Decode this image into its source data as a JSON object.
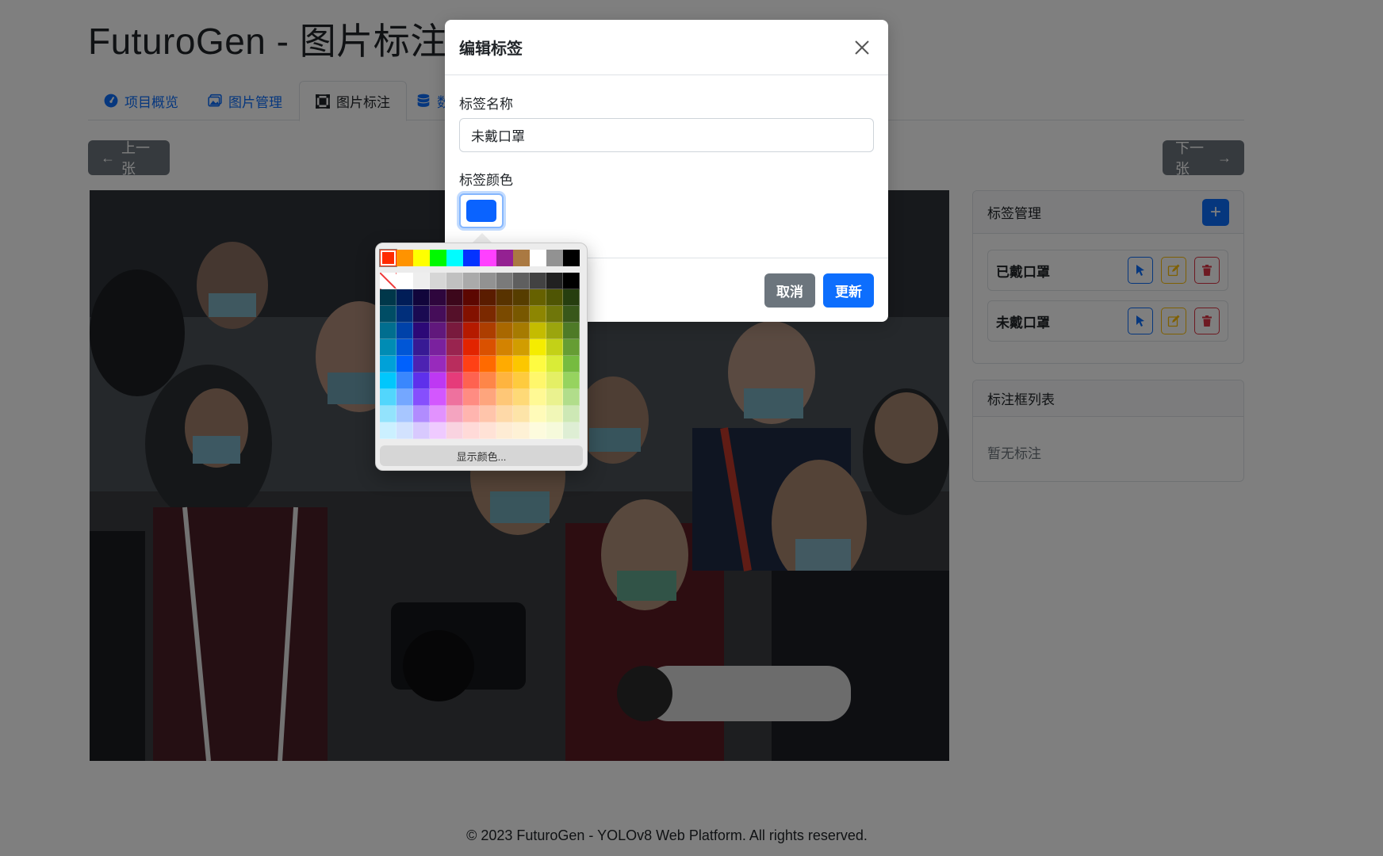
{
  "app_title": "FuturoGen - 图片标注",
  "tabs": [
    {
      "label": "项目概览",
      "icon": "gauge-icon"
    },
    {
      "label": "图片管理",
      "icon": "images-icon"
    },
    {
      "label": "图片标注",
      "icon": "bounding-box-icon",
      "active": true
    },
    {
      "label": "数",
      "icon": "database-icon"
    }
  ],
  "nav": {
    "prev_label": "上一张",
    "next_label": "下一张"
  },
  "label_panel": {
    "title": "标签管理",
    "add_label": "+",
    "labels": [
      {
        "name": "已戴口罩"
      },
      {
        "name": "未戴口罩"
      }
    ]
  },
  "box_panel": {
    "title": "标注框列表",
    "empty_text": "暂无标注"
  },
  "footer": "© 2023 FuturoGen - YOLOv8 Web Platform. All rights reserved.",
  "modal": {
    "title": "编辑标签",
    "name_label": "标签名称",
    "name_value": "未戴口罩",
    "color_label": "标签颜色",
    "color_value": "#0a63ff",
    "cancel_label": "取消",
    "update_label": "更新"
  },
  "palette": {
    "show_colors_label": "显示颜色...",
    "top_row": [
      "#ff2a00",
      "#ff9300",
      "#ffff00",
      "#00f900",
      "#00fdff",
      "#0433ff",
      "#ff40ff",
      "#942192",
      "#aa7942",
      "#ffffff",
      "#929292",
      "#000000"
    ],
    "grid": [
      [
        "none",
        "#ffffff",
        "#eeeeee",
        "#d6d6d6",
        "#c0c0c0",
        "#aaaaaa",
        "#929292",
        "#7a7a7a",
        "#5f5f5f",
        "#424242",
        "#212121",
        "#000000"
      ],
      [
        "#00374a",
        "#011d57",
        "#11053b",
        "#2e063d",
        "#3c071b",
        "#5c0701",
        "#5a1c00",
        "#583300",
        "#563d00",
        "#666100",
        "#4f5504",
        "#263e0f"
      ],
      [
        "#004d65",
        "#012f7b",
        "#1a0a52",
        "#450d59",
        "#551029",
        "#831100",
        "#7b2900",
        "#7a4a00",
        "#785800",
        "#8d8602",
        "#6f760a",
        "#38571a"
      ],
      [
        "#016e8f",
        "#0042a9",
        "#2c0977",
        "#61187c",
        "#791a3d",
        "#b51a00",
        "#ad3e00",
        "#a96800",
        "#a67b01",
        "#c4bc00",
        "#9ba50e",
        "#4e7a27"
      ],
      [
        "#008cb4",
        "#0056d6",
        "#371a94",
        "#7a219e",
        "#99244f",
        "#e22400",
        "#da5100",
        "#d38301",
        "#d19d01",
        "#f5ec00",
        "#c3d117",
        "#669d34"
      ],
      [
        "#00a1d8",
        "#0061fd",
        "#4d22b2",
        "#982abc",
        "#b92d5d",
        "#ff4015",
        "#ff6a00",
        "#ffab01",
        "#fcc700",
        "#fefb41",
        "#d9ec37",
        "#76bb40"
      ],
      [
        "#01c7fc",
        "#3a87fd",
        "#5e30eb",
        "#be38f3",
        "#e63b7a",
        "#fe6250",
        "#fe8648",
        "#feb43f",
        "#fecb3e",
        "#fff76b",
        "#e4ef65",
        "#96d35f"
      ],
      [
        "#52d6fc",
        "#74a7ff",
        "#864ffd",
        "#d357fe",
        "#ee719e",
        "#ff8c82",
        "#fea57d",
        "#fec777",
        "#fed977",
        "#fff994",
        "#eaf28f",
        "#b1dd8b"
      ],
      [
        "#93e3fc",
        "#a7c6ff",
        "#b18cfe",
        "#e292fe",
        "#f4a4c0",
        "#ffb5af",
        "#ffc5ab",
        "#fed9a8",
        "#fde4a8",
        "#fffbb9",
        "#f1f7b7",
        "#cde8b5"
      ],
      [
        "#cbf0ff",
        "#d2e2fe",
        "#d8c9fe",
        "#efcaff",
        "#f9d3e0",
        "#ffdad8",
        "#ffe2d6",
        "#feecd4",
        "#fef1d5",
        "#fdfbdd",
        "#f6fadb",
        "#deeed4"
      ]
    ]
  },
  "colors": {
    "primary": "#0d6efd",
    "secondary": "#6c757d",
    "warning": "#ffc107",
    "danger": "#dc3545"
  }
}
